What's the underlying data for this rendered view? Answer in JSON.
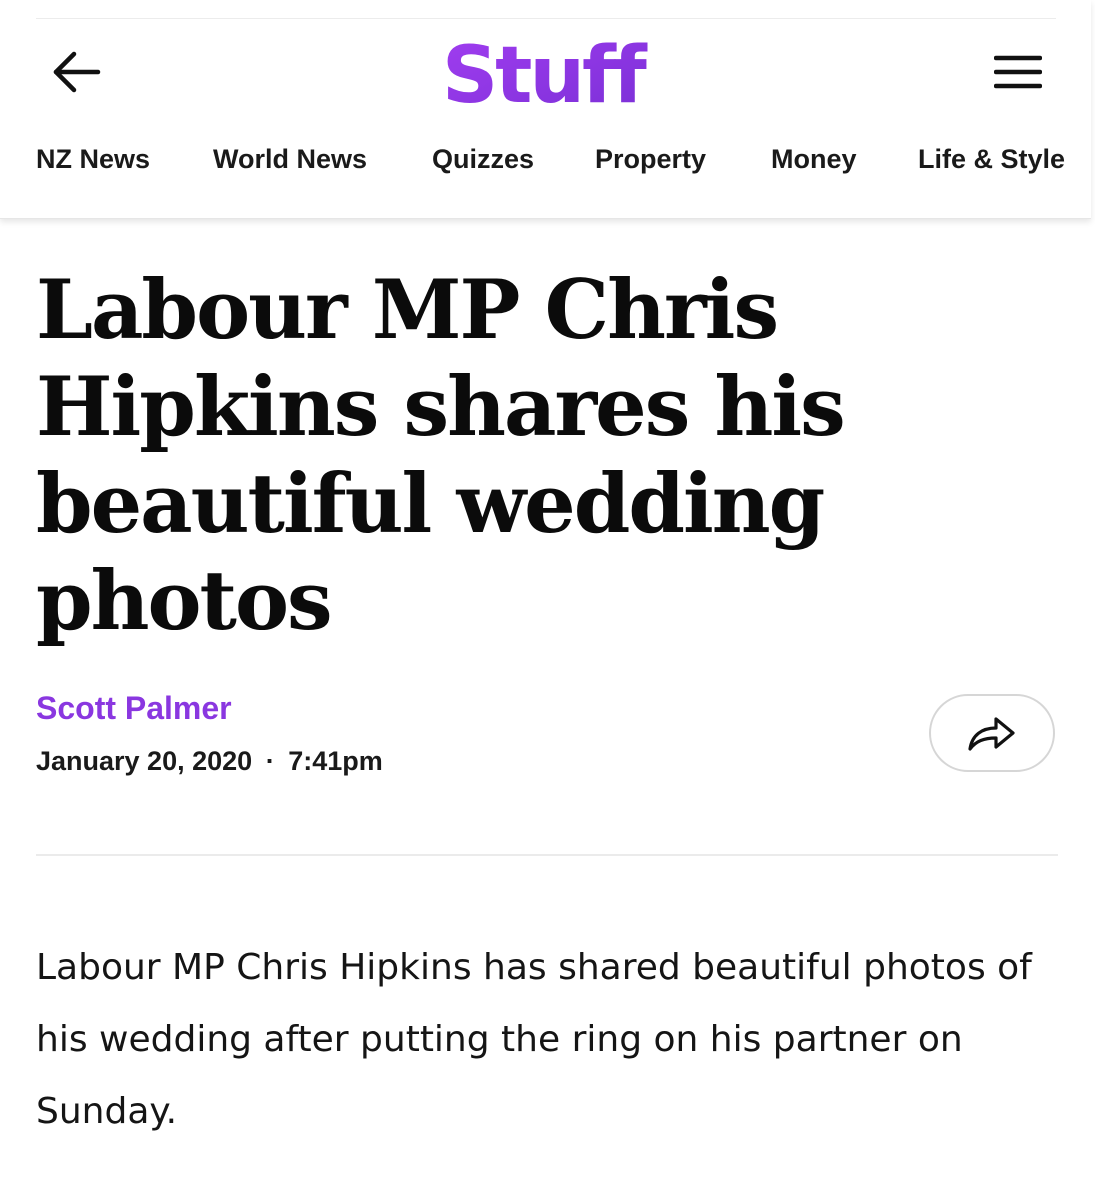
{
  "header": {
    "logo_text": "Stuff",
    "brand_color": "#8a37e0",
    "nav": [
      {
        "label": "NZ News"
      },
      {
        "label": "World News"
      },
      {
        "label": "Quizzes"
      },
      {
        "label": "Property"
      },
      {
        "label": "Money"
      },
      {
        "label": "Life & Style"
      }
    ]
  },
  "icons": {
    "back": "arrow-left-icon",
    "menu": "hamburger-menu-icon",
    "share": "share-arrow-icon"
  },
  "article": {
    "headline": "Labour MP Chris Hipkins shares his beautiful wedding photos",
    "author": "Scott Palmer",
    "date": "January 20, 2020",
    "separator": "·",
    "time": "7:41pm",
    "body": "Labour MP Chris Hipkins has shared beautiful photos of his wedding after putting the ring on his partner on Sunday."
  }
}
